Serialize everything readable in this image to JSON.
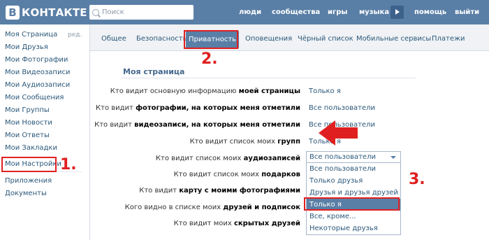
{
  "header": {
    "logo_letter": "В",
    "logo_text": "КОНТАКТЕ",
    "search_placeholder": "Поиск",
    "nav": [
      "люди",
      "сообщества",
      "игры",
      "музыка",
      "помощь",
      "выйти"
    ]
  },
  "sidebar": {
    "edit_label": "ред.",
    "items": [
      "Моя Страница",
      "Мои Друзья",
      "Мои Фотографии",
      "Мои Видеозаписи",
      "Мои Аудиозаписи",
      "Мои Сообщения",
      "Мои Группы",
      "Мои Новости",
      "Мои Ответы",
      "Мои Закладки",
      "Мои Настройки"
    ],
    "extra": [
      "Приложения",
      "Документы"
    ]
  },
  "tabs": [
    "Общее",
    "Безопасность",
    "Приватность",
    "Оповещения",
    "Чёрный список",
    "Мобильные сервисы",
    "Платежи"
  ],
  "active_tab": "Приватность",
  "section_title": "Моя страница",
  "rows": [
    {
      "pre": "Кто видит основную информацию ",
      "bold": "моей страницы",
      "value": "Только я"
    },
    {
      "pre": "Кто видит ",
      "bold": "фотографии, на которых меня отметили",
      "value": "Все пользователи"
    },
    {
      "pre": "Кто видит ",
      "bold": "видеозаписи, на которых меня отметили",
      "value": "Все пользователи"
    },
    {
      "pre": "Кто видит список моих ",
      "bold": "групп",
      "value": "Только я"
    },
    {
      "pre": "Кто видит список моих ",
      "bold": "аудиозаписей",
      "value": ""
    },
    {
      "pre": "Кто видит список моих ",
      "bold": "подарков",
      "value": ""
    },
    {
      "pre": "Кто видит ",
      "bold": "карту с моими фотографиями",
      "value": ""
    },
    {
      "pre": "Кого видно в списке моих ",
      "bold": "друзей и подписок",
      "value": ""
    },
    {
      "pre": "Кто видит моих ",
      "bold": "скрытых друзей",
      "value": ""
    }
  ],
  "dropdown": {
    "current": "Все пользователи",
    "options": [
      "Все пользователи",
      "Только друзья",
      "Друзья и друзья друзей",
      "Только я",
      "Все, кроме...",
      "Некоторые друзья"
    ],
    "selected_index": 3
  },
  "annotations": [
    "1.",
    "2.",
    "3."
  ],
  "colors": {
    "header": "#5a7fa6",
    "link": "#2b587a",
    "annotation": "#e02020"
  }
}
